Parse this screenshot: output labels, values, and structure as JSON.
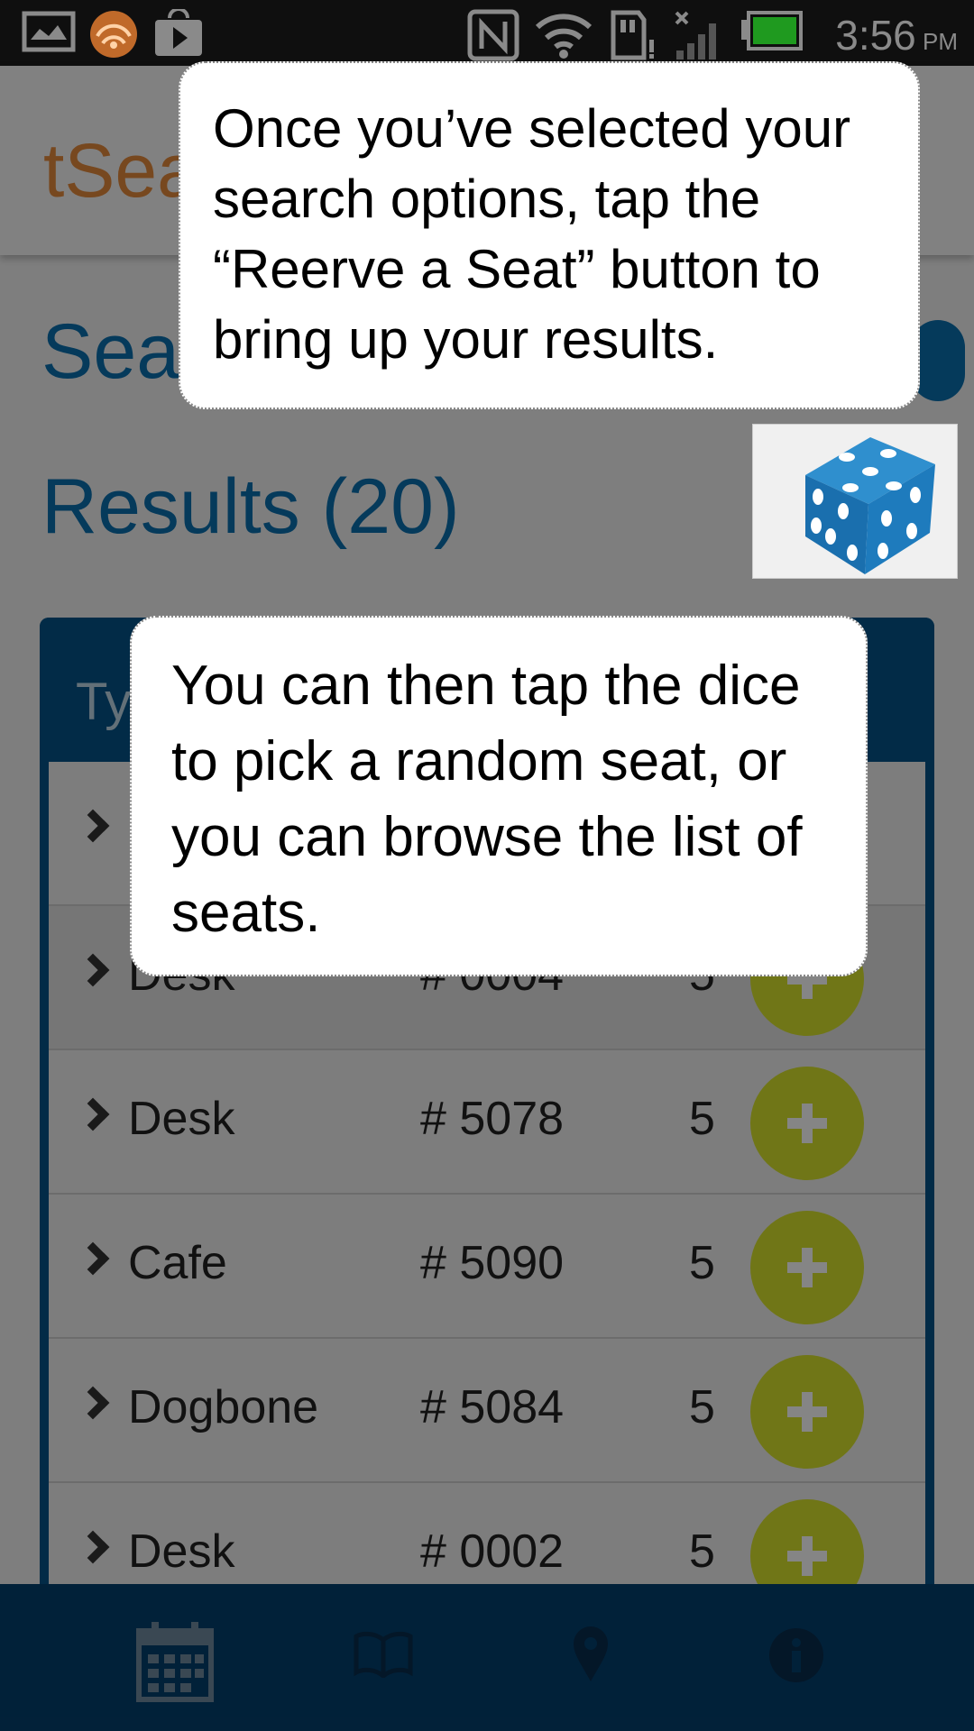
{
  "status_bar": {
    "time": "3:56",
    "ampm": "PM",
    "icons": [
      "photo-icon",
      "wifi-hotspot-icon",
      "play-store-icon",
      "nfc-icon",
      "wifi-icon",
      "sd-card-icon",
      "no-signal-icon",
      "battery-icon"
    ]
  },
  "app": {
    "title": "tSea",
    "search_heading": "Sea",
    "results_heading": "Results (20)",
    "table_header_partial": "Ty"
  },
  "rows": [
    {
      "type": "",
      "number": "",
      "capacity": ""
    },
    {
      "type": "Desk",
      "number": "# 0004",
      "capacity": "5"
    },
    {
      "type": "Desk",
      "number": "# 5078",
      "capacity": "5"
    },
    {
      "type": "Cafe",
      "number": "# 5090",
      "capacity": "5"
    },
    {
      "type": "Dogbone",
      "number": "# 5084",
      "capacity": "5"
    },
    {
      "type": "Desk",
      "number": "# 0002",
      "capacity": "5"
    }
  ],
  "bottom_nav": [
    "calendar-icon",
    "book-icon",
    "map-pin-icon",
    "info-icon"
  ],
  "tutorial": {
    "bubble1": "Once you’ve selected your search options, tap the “Reerve a Seat” button to bring up your results.",
    "bubble2": " You can then tap the dice to pick a random seat, or you can browse the list of seats."
  },
  "colors": {
    "accent_orange": "#e58a3c",
    "primary_blue": "#0b6fae",
    "dark_blue": "#045488",
    "add_green": "#d6e22c"
  }
}
